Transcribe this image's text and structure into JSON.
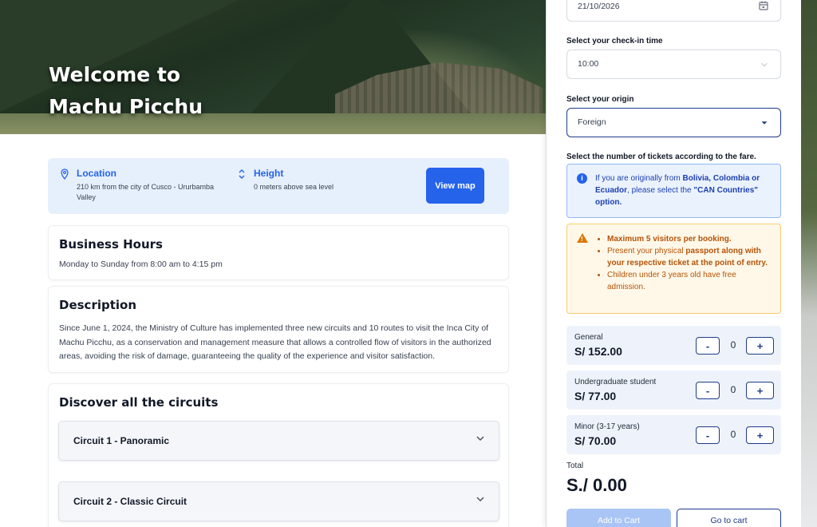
{
  "hero": {
    "title_line1": "Welcome to",
    "title_line2": "Machu Picchu"
  },
  "info": {
    "location_label": "Location",
    "location_value": "210 km from the city of Cusco - Ururbamba Valley",
    "height_label": "Height",
    "height_value": "0 meters above sea level",
    "view_map_label": "View map"
  },
  "business_hours": {
    "title": "Business Hours",
    "text": "Monday to Sunday from 8:00 am to 4:15 pm"
  },
  "description": {
    "title": "Description",
    "text": "Since June 1, 2024, the Ministry of Culture has implemented three new circuits and 10 routes to visit the Inca City of Machu Picchu, as a conservation and management measure that allows a controlled flow of visitors in the authorized areas, avoiding the risk of damage, guaranteeing the quality of the experience and visitor satisfaction."
  },
  "circuits": {
    "title": "Discover all the circuits",
    "items": [
      {
        "label": "Circuit 1 - Panoramic"
      },
      {
        "label": "Circuit 2 - Classic Circuit"
      }
    ]
  },
  "booking": {
    "date_value": "21/10/2026",
    "checkin_label": "Select your check-in time",
    "checkin_value": "10:00",
    "origin_label": "Select your origin",
    "origin_value": "Foreign",
    "tickets_label": "Select the number of tickets according to the fare.",
    "info_alert": {
      "p1": "If you are originally from ",
      "b1": "Bolivia, Colombia or Ecuador",
      "p2": ", please select the ",
      "b2": "\"CAN Countries\" option."
    },
    "warn_alert": {
      "item1": "Maximum 5 visitors per booking.",
      "item2_pre": "Present your physical ",
      "item2_bold": "passport along with your respective ticket at the point of entry.",
      "item3": "Children under 3 years old have free admission."
    },
    "fares": [
      {
        "name": "General",
        "price": "S/ 152.00",
        "qty": "0"
      },
      {
        "name": "Undergraduate student",
        "price": "S/ 77.00",
        "qty": "0"
      },
      {
        "name": "Minor (3-17 years)",
        "price": "S/ 70.00",
        "qty": "0"
      }
    ],
    "minus": "-",
    "plus": "+",
    "total_label": "Total",
    "total_value": "S./ 0.00",
    "add_to_cart": "Add to Cart",
    "go_to_cart": "Go to cart"
  },
  "colors": {
    "accent": "#2563eb",
    "navy": "#1e3a8a",
    "warn": "#b45309",
    "info_bg": "#eaf2fe",
    "warn_bg": "#fff8e8"
  },
  "icons": {
    "location": "map-pin-icon",
    "height": "up-down-arrows-icon",
    "calendar": "calendar-icon",
    "chevron": "chevron-down-icon",
    "info": "info-icon",
    "warning": "warning-icon"
  }
}
